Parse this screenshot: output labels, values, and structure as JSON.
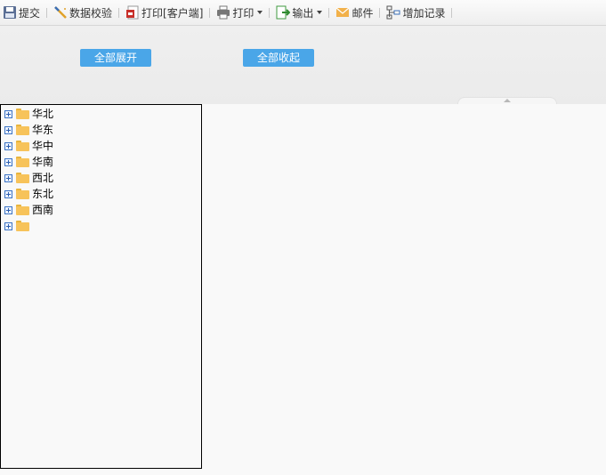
{
  "toolbar": {
    "items": [
      {
        "label": "提交",
        "icon": "save-icon"
      },
      {
        "label": "数据校验",
        "icon": "wand-icon"
      },
      {
        "label": "打印[客户端]",
        "icon": "pdf-print-icon"
      },
      {
        "label": "打印",
        "icon": "printer-icon"
      },
      {
        "label": "输出",
        "icon": "export-icon"
      },
      {
        "label": "邮件",
        "icon": "mail-icon"
      },
      {
        "label": "增加记录",
        "icon": "add-record-icon"
      }
    ]
  },
  "buttons": {
    "expand_all": "全部展开",
    "collapse_all": "全部收起"
  },
  "tree": {
    "nodes": [
      "华北",
      "华东",
      "华中",
      "华南",
      "西北",
      "东北",
      "西南",
      ""
    ]
  },
  "colors": {
    "button_bg": "#4aa6e8",
    "folder": "#f7c35a",
    "expander_border": "#3b73c5"
  }
}
